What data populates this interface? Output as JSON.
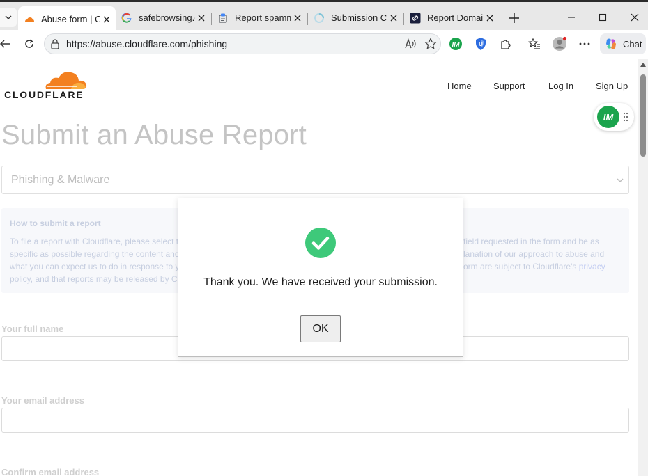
{
  "tabs": [
    {
      "title": "Abuse form | Cl",
      "icon": "cloudflare-icon",
      "active": true
    },
    {
      "title": "safebrowsing.g",
      "icon": "google-icon",
      "active": false
    },
    {
      "title": "Report spammy",
      "icon": "report-icon",
      "active": false
    },
    {
      "title": "Submission Cor",
      "icon": "loading-icon",
      "active": false
    },
    {
      "title": "Report Domain",
      "icon": "link-icon",
      "active": false
    }
  ],
  "address_bar": {
    "url": "https://abuse.cloudflare.com/phishing"
  },
  "toolbar": {
    "chat_label": "Chat"
  },
  "site": {
    "logo_text": "CLOUDFLARE",
    "nav": [
      "Home",
      "Support",
      "Log In",
      "Sign Up"
    ],
    "widget_badge": "IM"
  },
  "page": {
    "title": "Submit an Abuse Report",
    "report_type": "Phishing & Malware",
    "info": {
      "heading": "How to submit a report",
      "line1_left": "To file a report with Cloudflare, please select t",
      "line2_left": "specific as possible regarding the content and",
      "line3_left": "what you can expect us to do in response to y",
      "line4_left": "policy, and that reports may be released by Cl",
      "line1_right": "field requested in the form and be as",
      "line2_right": "lanation of our approach to abuse and",
      "line3_right_text": "orm are subject to Cloudflare's",
      "line3_right_link": "privacy"
    },
    "fields": {
      "full_name_label": "Your full name",
      "email_label": "Your email address",
      "confirm_email_label": "Confirm email address"
    }
  },
  "modal": {
    "message": "Thank you. We have received your submission.",
    "ok_label": "OK"
  },
  "colors": {
    "cloudflare_orange": "#f38020",
    "success_green": "#3ec97a",
    "badge_green": "#1ba44d"
  }
}
